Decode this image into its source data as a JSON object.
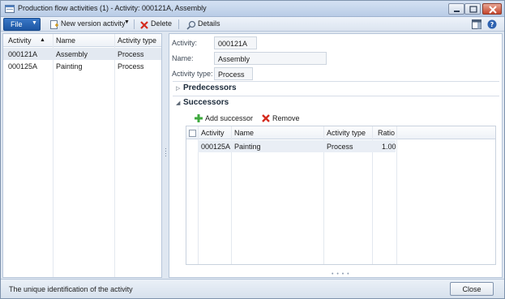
{
  "window": {
    "title": "Production flow activities (1) - Activity: 000121A, Assembly"
  },
  "toolbar": {
    "file_label": "File",
    "new_version_label": "New version activity",
    "delete_label": "Delete",
    "details_label": "Details"
  },
  "activity_list": {
    "columns": [
      "Activity",
      "Name",
      "Activity type"
    ],
    "rows": [
      {
        "activity": "000121A",
        "name": "Assembly",
        "type": "Process"
      },
      {
        "activity": "000125A",
        "name": "Painting",
        "type": "Process"
      }
    ]
  },
  "detail": {
    "activity_label": "Activity:",
    "activity_value": "000121A",
    "name_label": "Name:",
    "name_value": "Assembly",
    "type_label": "Activity type:",
    "type_value": "Process",
    "predecessors_label": "Predecessors",
    "successors_label": "Successors",
    "add_successor_label": "Add successor",
    "remove_label": "Remove"
  },
  "successors_grid": {
    "columns": [
      "Activity",
      "Name",
      "Activity type",
      "Ratio"
    ],
    "rows": [
      {
        "activity": "000125A",
        "name": "Painting",
        "type": "Process",
        "ratio": "1.00"
      }
    ]
  },
  "status": {
    "text": "The unique identification of the activity",
    "close_label": "Close"
  },
  "colors": {
    "file_button": "#2a66b5",
    "add_icon": "#3ea93e",
    "remove_icon": "#d42b1e"
  }
}
